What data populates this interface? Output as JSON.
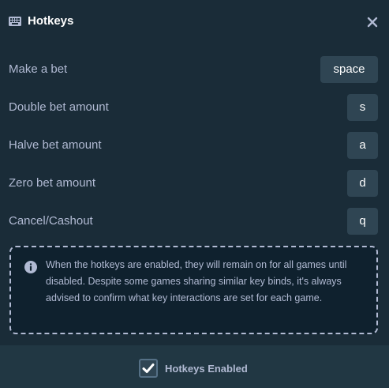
{
  "header": {
    "title": "Hotkeys",
    "keyboard_icon": "keyboard-icon",
    "close_icon": "close-icon"
  },
  "hotkeys": [
    {
      "label": "Make a bet",
      "key": "space"
    },
    {
      "label": "Double bet amount",
      "key": "s"
    },
    {
      "label": "Halve bet amount",
      "key": "a"
    },
    {
      "label": "Zero bet amount",
      "key": "d"
    },
    {
      "label": "Cancel/Cashout",
      "key": "q"
    }
  ],
  "info": {
    "icon": "info-icon",
    "text": "When the hotkeys are enabled, they will remain on for all games until disabled. Despite some games sharing similar key binds, it's always advised to confirm what key interactions are set for each game."
  },
  "footer": {
    "checkbox_checked": true,
    "checkbox_label": "Hotkeys Enabled"
  },
  "colors": {
    "background": "#1a2c38",
    "key_background": "#2f4553",
    "footer_background": "#213743",
    "info_background": "#0f212e",
    "text": "#b1bad3",
    "white": "#ffffff"
  }
}
